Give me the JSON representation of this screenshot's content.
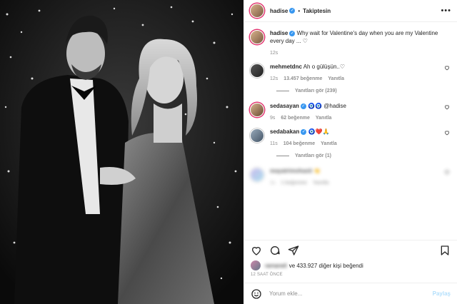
{
  "header": {
    "username": "hadise",
    "follow_label": "Takiptesin",
    "separator": "•",
    "more_label": "•••"
  },
  "caption": {
    "username": "hadise",
    "text": "Why wait for Valentine's day when you are my Valentine every day ... ♡",
    "time": "12s"
  },
  "comments": [
    {
      "username": "mehmetdnc",
      "text": "Ah o gülüşün..♡",
      "time": "12s",
      "likes": "13.457 beğenme",
      "reply": "Yanıtla",
      "replies": "Yanıtları gör (239)"
    },
    {
      "username": "sedasayan",
      "text": "🧿🧿 @hadise",
      "time": "9s",
      "likes": "62 beğenme",
      "reply": "Yanıtla"
    },
    {
      "username": "sedabakan",
      "text": "🧿❤️🙏",
      "time": "11s",
      "likes": "104 beğenme",
      "reply": "Yanıtla",
      "replies": "Yanıtları gör (1)"
    },
    {
      "username": "mayatrimohasti",
      "text": "👏",
      "time": "1s",
      "likes": "1 beğenme",
      "reply": "Yanıtla"
    }
  ],
  "likes": {
    "blurred_name": "ramaneli",
    "text": "ve 433.927 diğer kişi beğendi"
  },
  "timestamp": "12 SAAT ÖNCE",
  "composer": {
    "placeholder": "Yorum ekle...",
    "post_label": "Paylaş"
  },
  "colors": {
    "accent_blue": "#3897f0",
    "post_disabled": "#b2dffc",
    "muted": "#8e8e8e",
    "text": "#262626"
  },
  "icons": [
    "heart-icon",
    "comment-icon",
    "share-icon",
    "bookmark-icon",
    "emoji-icon",
    "more-icon",
    "verified-icon"
  ]
}
